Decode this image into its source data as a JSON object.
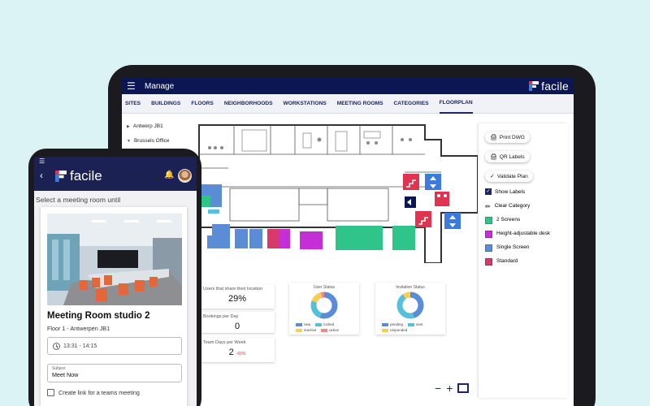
{
  "tablet": {
    "app_title": "Manage",
    "brand_name": "facile",
    "tabs": [
      "SITES",
      "BUILDINGS",
      "FLOORS",
      "NEIGHBORHOODS",
      "WORKSTATIONS",
      "MEETING ROOMS",
      "CATEGORIES",
      "FLOORPLAN"
    ],
    "active_tab": "FLOORPLAN",
    "tree": [
      "Antwerp JB1",
      "Brussels Office"
    ],
    "actions": {
      "print_dwg": "Print DWG",
      "qr_labels": "QR Labels",
      "validate_plan": "Validate Plan",
      "show_labels": "Show Labels",
      "clear_category": "Clear Category"
    },
    "categories": [
      {
        "label": "2 Screens",
        "color": "#2ec48a"
      },
      {
        "label": "Height-adjustable desk",
        "color": "#c42fd6"
      },
      {
        "label": "Single Screen",
        "color": "#5b8dd6"
      },
      {
        "label": "Standard",
        "color": "#d63a6a"
      }
    ],
    "stats": [
      {
        "label": "Users that share their location",
        "value": "29%"
      },
      {
        "label": "Bookings per Day",
        "value": "0"
      },
      {
        "label": "Team Days per Week",
        "value": "2",
        "delta": "-65%"
      }
    ],
    "user_status": {
      "title": "User Status",
      "legend": [
        "new",
        "locked",
        "inactive",
        "active"
      ],
      "colors": [
        "#5b8dd6",
        "#55c0d9",
        "#f5cd57",
        "#f08a8a"
      ],
      "shares": [
        0.55,
        0.25,
        0.15,
        0.05
      ]
    },
    "invitation_status": {
      "title": "Invitation Status",
      "legend": [
        "pending",
        "sent",
        "responded"
      ],
      "colors": [
        "#5b8dd6",
        "#55c0d9",
        "#f5cd57"
      ],
      "shares": [
        0.45,
        0.45,
        0.1
      ]
    }
  },
  "phone": {
    "brand_name": "facile",
    "header": "Select a meeting room until",
    "room_name": "Meeting Room studio 2",
    "floor": "Floor 1 - Antwerpen JB1",
    "time": "13:31 - 14:15",
    "subject_label": "Subject",
    "subject_value": "Meet Now",
    "teams_label": "Create link for a teams meeting"
  },
  "colors": {
    "navy": "#0c1652",
    "accent_red": "#e0334f",
    "accent_blue": "#3b7be0"
  }
}
